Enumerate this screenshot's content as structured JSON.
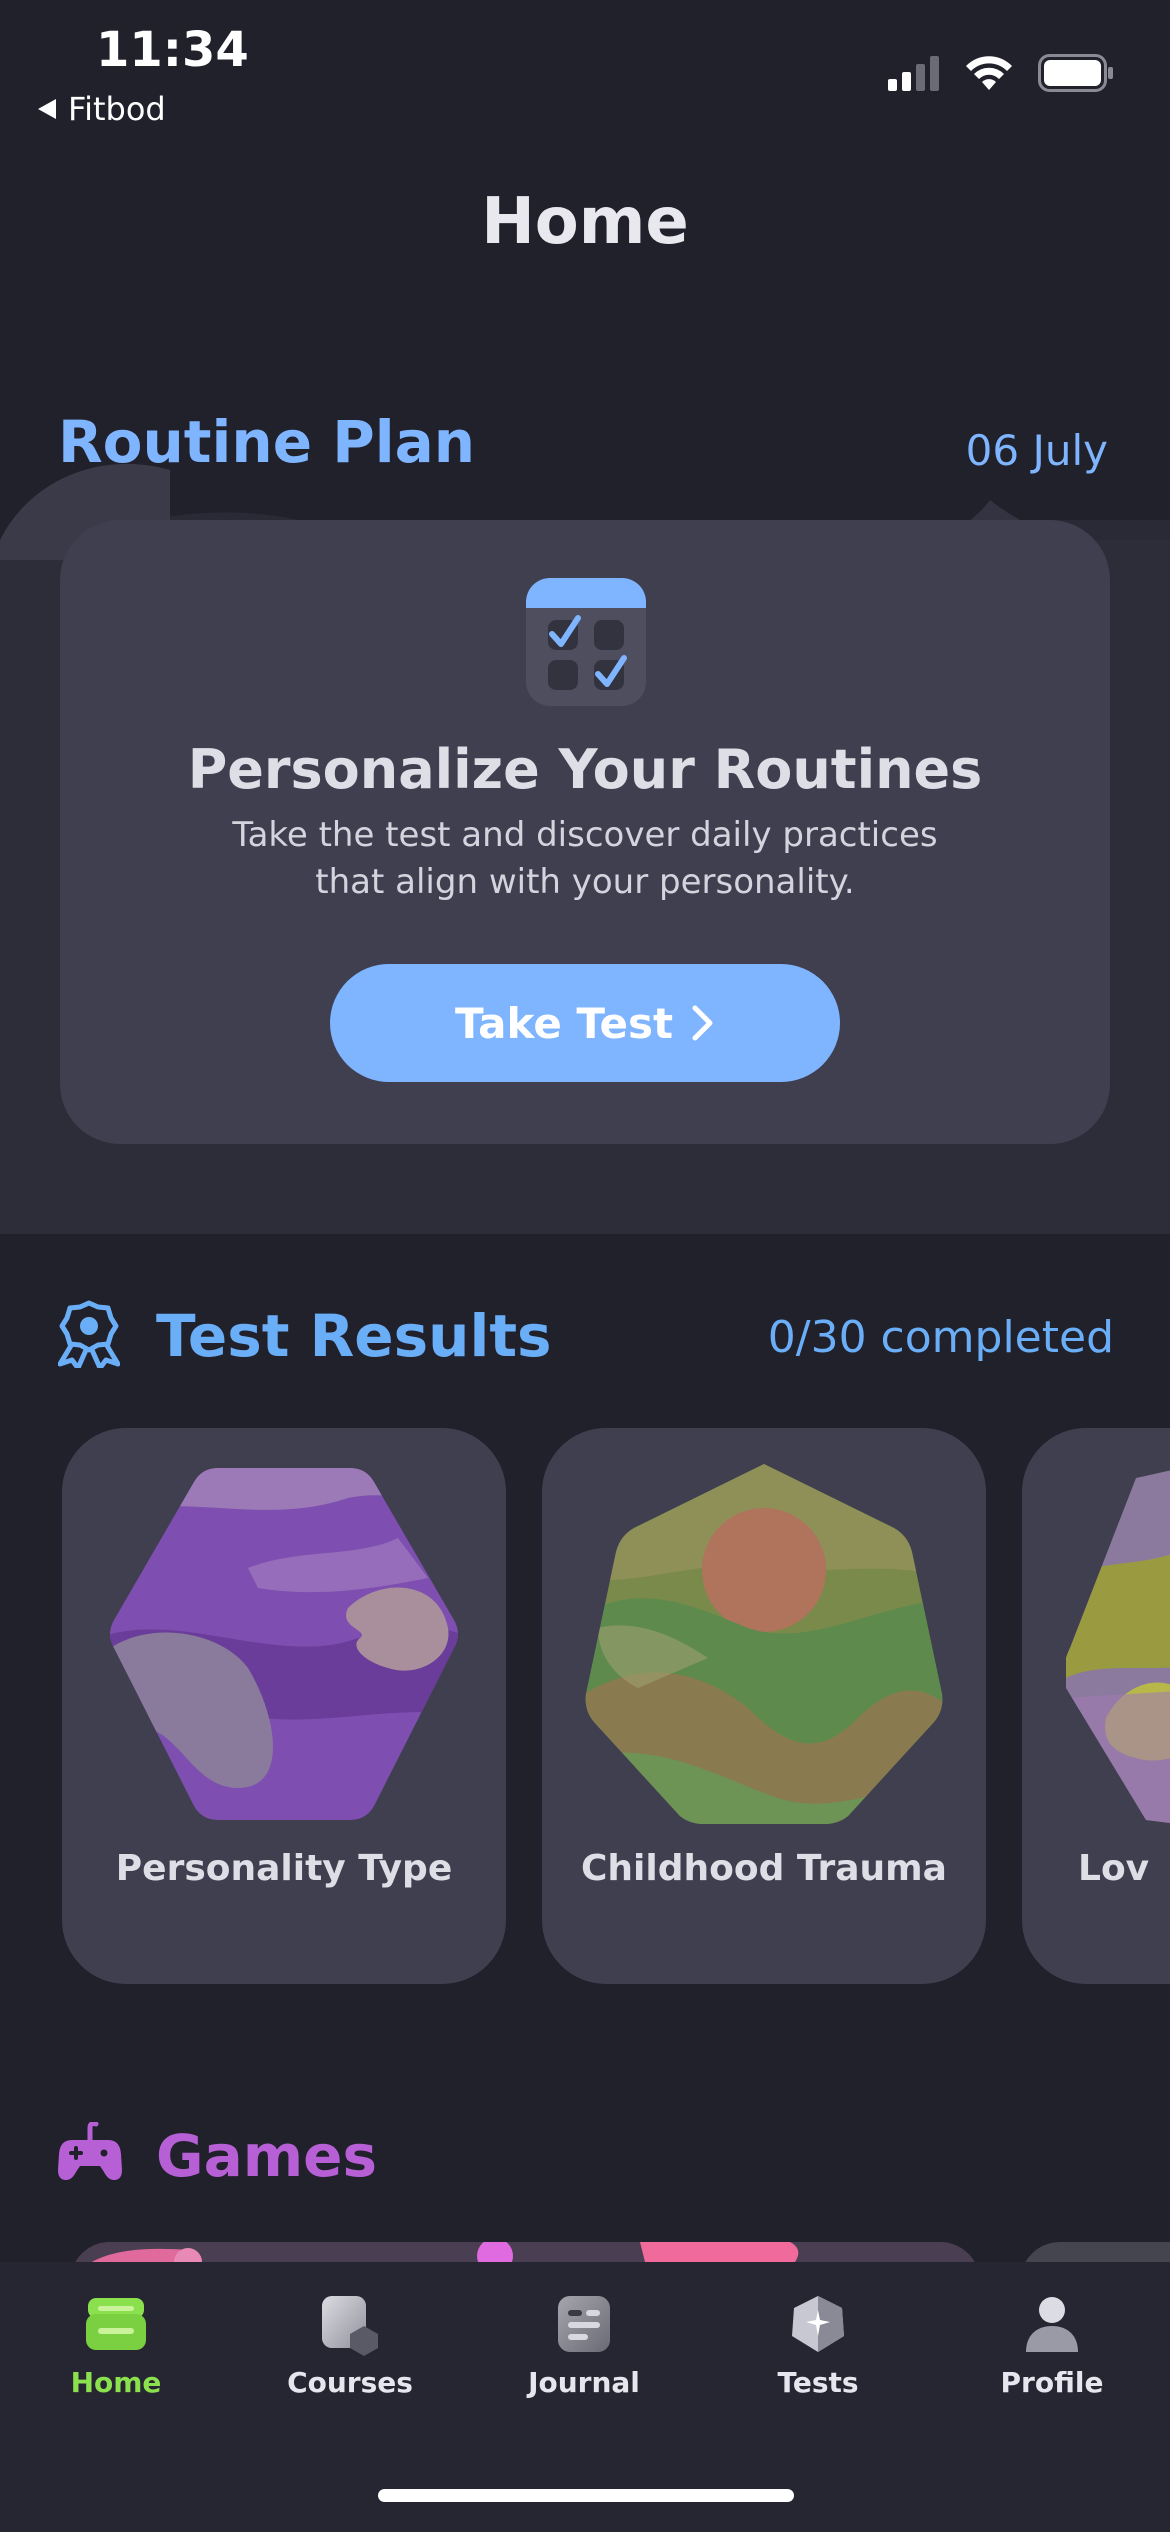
{
  "status": {
    "time": "11:34",
    "back_label": "Fitbod"
  },
  "header": {
    "title": "Home"
  },
  "routine": {
    "title": "Routine Plan",
    "date": "06 July",
    "card_title": "Personalize Your Routines",
    "card_subtitle": "Take the test and discover daily practices that align with your personality.",
    "button_label": "Take Test"
  },
  "test_results": {
    "title": "Test Results",
    "count": "0/30 completed",
    "cards": [
      {
        "label": "Personality Type"
      },
      {
        "label": "Childhood Trauma"
      },
      {
        "label": "Lov"
      }
    ]
  },
  "games": {
    "title": "Games"
  },
  "tabs": [
    {
      "label": "Home",
      "active": true
    },
    {
      "label": "Courses",
      "active": false
    },
    {
      "label": "Journal",
      "active": false
    },
    {
      "label": "Tests",
      "active": false
    },
    {
      "label": "Profile",
      "active": false
    }
  ],
  "colors": {
    "accent_blue": "#7fb4ff",
    "games_purple": "#b760d6",
    "active_tab": "#8be04e"
  }
}
